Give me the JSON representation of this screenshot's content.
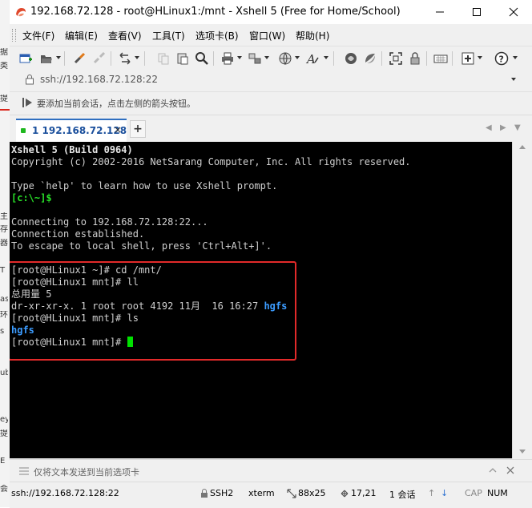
{
  "window": {
    "title": "192.168.72.128 - root@HLinux1:/mnt - Xshell 5 (Free for Home/School)"
  },
  "background_glyphs": [
    "据",
    "类",
    "提",
    "主",
    "存",
    "器",
    "T",
    "as",
    "环",
    "s",
    "ub",
    "ey",
    "提",
    "E",
    "会"
  ],
  "menu": {
    "items": [
      "文件(F)",
      "编辑(E)",
      "查看(V)",
      "工具(T)",
      "选项卡(B)",
      "窗口(W)",
      "帮助(H)"
    ]
  },
  "address": {
    "value": "ssh://192.168.72.128:22"
  },
  "hint": {
    "text": "要添加当前会话，点击左侧的箭头按钮。"
  },
  "tabs": [
    {
      "label": "1 192.168.72.128",
      "close": "×"
    }
  ],
  "tab_add": "+",
  "terminal": {
    "header_bold": "Xshell 5 (Build 0964)",
    "copyright": "Copyright (c) 2002-2016 NetSarang Computer, Inc. All rights reserved.",
    "help_line": "Type `help' to learn how to use Xshell prompt.",
    "local_prompt": "[c:\\~]$",
    "connecting": "Connecting to 192.168.72.128:22...",
    "established": "Connection established.",
    "escape": "To escape to local shell, press 'Ctrl+Alt+]'.",
    "cmd1": "[root@HLinux1 ~]# cd /mnt/",
    "cmd2": "[root@HLinux1 mnt]# ll",
    "total": "总用量 5",
    "ll_row_prefix": "dr-xr-xr-x. 1 root root 4192 11月  16 16:27 ",
    "ll_row_name": "hgfs",
    "cmd3": "[root@HLinux1 mnt]# ls",
    "ls_out": "hgfs",
    "cmd4": "[root@HLinux1 mnt]# "
  },
  "compose": {
    "placeholder": "仅将文本发送到当前选项卡"
  },
  "status": {
    "address": "ssh://192.168.72.128:22",
    "protocol": "SSH2",
    "term": "xterm",
    "size": "88x25",
    "cursor_pos": "17,21",
    "sessions": "1 会话",
    "caps": "CAP",
    "num": "NUM"
  },
  "colors": {
    "terminal_bg": "#000000",
    "prompt_green": "#28e028",
    "dir_blue": "#3c9cff",
    "highlight_red": "#e22a2a",
    "tab_accent": "#2f6fc0"
  }
}
